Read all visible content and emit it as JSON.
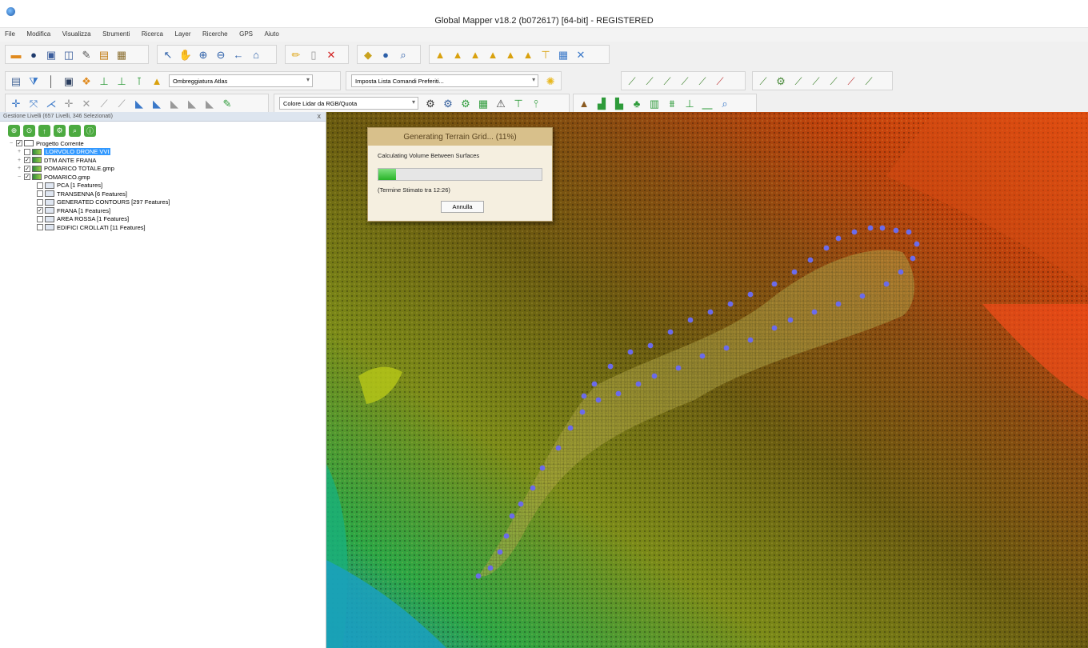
{
  "window": {
    "title": "Global Mapper v18.2 (b072617) [64-bit] - REGISTERED"
  },
  "menu": [
    "File",
    "Modifica",
    "Visualizza",
    "Strumenti",
    "Ricerca",
    "Layer",
    "Ricerche",
    "GPS",
    "Aiuto"
  ],
  "toolbar": {
    "shader_combo": "Ombreggiatura Atlas",
    "commands_combo": "Imposta Lista Comandi Preferiti...",
    "lidar_combo": "Colore Lidar da RGB/Quota"
  },
  "panel": {
    "header": "Gestione Livelli (657 Livelli, 346 Selezionati)",
    "close_glyph": "x",
    "layers": [
      {
        "label": "Progetto Corrente",
        "checked": true,
        "expander": "−",
        "icon": "project",
        "selected": false
      },
      {
        "label": "LORVOLO DRONE VVI",
        "checked": false,
        "expander": "+",
        "icon": "raster",
        "selected": true
      },
      {
        "label": "DTM ANTE FRANA",
        "checked": true,
        "expander": "+",
        "icon": "raster",
        "selected": false
      },
      {
        "label": "POMARICO TOTALE.gmp",
        "checked": true,
        "expander": "+",
        "icon": "raster",
        "selected": false
      },
      {
        "label": "POMARICO.gmp",
        "checked": true,
        "expander": "−",
        "icon": "raster",
        "selected": false
      },
      {
        "label": "PCA [1 Features]",
        "checked": false,
        "expander": "",
        "icon": "vector",
        "selected": false
      },
      {
        "label": "TRANSENNA [6 Features]",
        "checked": false,
        "expander": "",
        "icon": "vector",
        "selected": false
      },
      {
        "label": "GENERATED CONTOURS [297 Features]",
        "checked": false,
        "expander": "",
        "icon": "vector",
        "selected": false
      },
      {
        "label": "FRANA [1 Features]",
        "checked": true,
        "expander": "",
        "icon": "vector",
        "selected": false
      },
      {
        "label": "AREA ROSSA [1 Features]",
        "checked": false,
        "expander": "",
        "icon": "vector",
        "selected": false
      },
      {
        "label": "EDIFICI CROLLATI [11 Features]",
        "checked": false,
        "expander": "",
        "icon": "vector",
        "selected": false
      }
    ]
  },
  "dialog": {
    "title": "Generating Terrain Grid... (11%)",
    "message": "Calculating Volume Between Surfaces",
    "progress": 0.11,
    "time": "(Termine Stimato tra 12:26)",
    "cancel_label": "Annulla"
  },
  "colors": {
    "selection": "#3399ff",
    "progress_fill": "#28b428",
    "polygon_vertex": "#6b6bea",
    "polygon_fill": "#a5a04a"
  }
}
